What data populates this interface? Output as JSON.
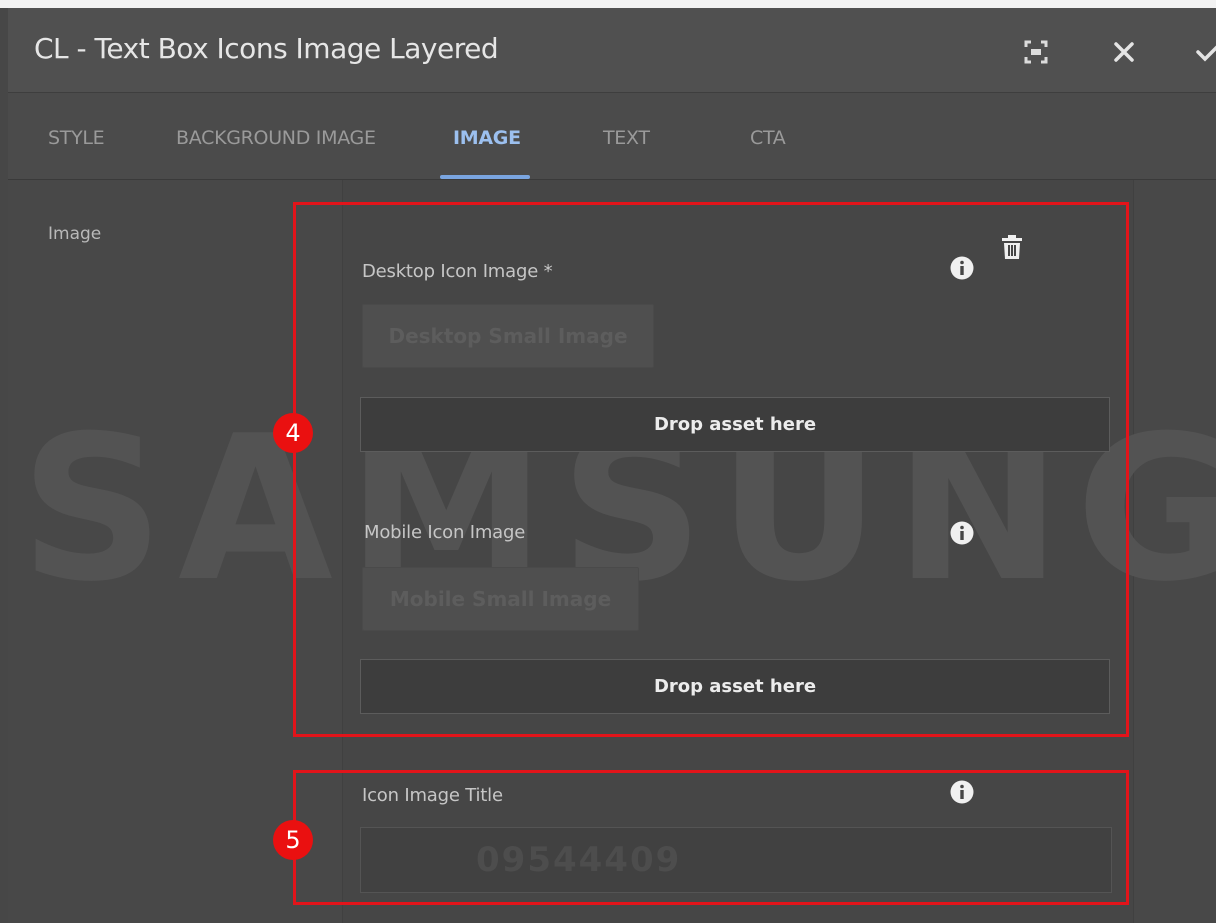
{
  "dialog": {
    "title": "CL - Text Box Icons Image Layered",
    "icons": [
      "fullscreen-icon",
      "close-icon",
      "checkmark-icon"
    ]
  },
  "tabs": [
    {
      "label": "STYLE",
      "active": false
    },
    {
      "label": "BACKGROUND IMAGE",
      "active": false
    },
    {
      "label": "IMAGE",
      "active": true
    },
    {
      "label": "TEXT",
      "active": false
    },
    {
      "label": "CTA",
      "active": false
    }
  ],
  "section_label": "Image",
  "desktop_icon": {
    "label": "Desktop Icon Image *",
    "placeholder_image": "Desktop Small Image",
    "drop_label": "Drop asset here"
  },
  "mobile_icon": {
    "label": "Mobile Icon Image",
    "placeholder_image": "Mobile Small Image",
    "drop_label": "Drop asset here"
  },
  "icon_title": {
    "label": "Icon Image Title",
    "value": "09544409"
  },
  "callouts": [
    "4",
    "5"
  ],
  "watermark": "SAMSUNG",
  "colors": {
    "accent": "#7aa5e0",
    "callout": "#e2141a",
    "background": "#474747"
  }
}
